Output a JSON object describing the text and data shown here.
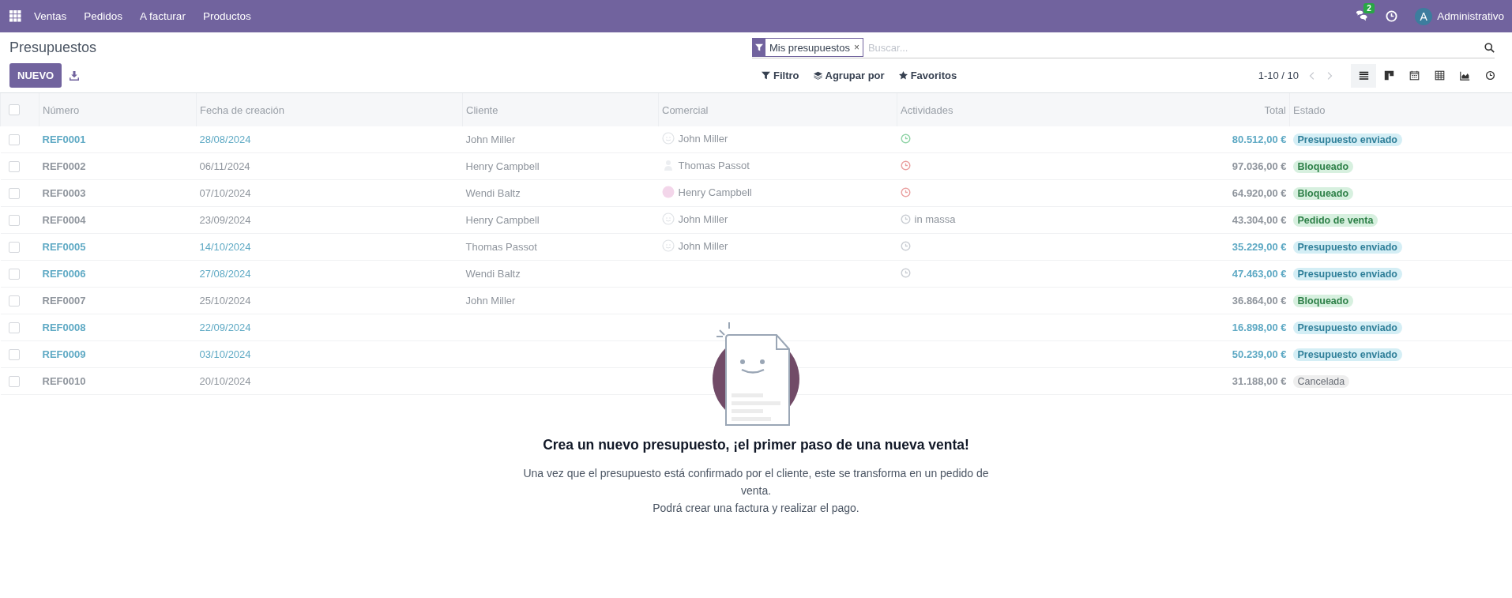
{
  "navbar": {
    "app": "Ventas",
    "menus": [
      "Pedidos",
      "A facturar",
      "Productos"
    ],
    "messages_count": "2",
    "user_initial": "A",
    "user_name": "Administrativo"
  },
  "control_panel": {
    "title": "Presupuestos",
    "new_button": "NUEVO",
    "facet": "Mis presupuestos",
    "facet_remove": "×",
    "search_placeholder": "Buscar...",
    "filters": [
      {
        "kind": "filter",
        "label": "Filtro"
      },
      {
        "kind": "group",
        "label": "Agrupar por"
      },
      {
        "kind": "favorite",
        "label": "Favoritos"
      }
    ],
    "pager": "1-10 / 10",
    "views": [
      {
        "kind": "list",
        "selected": true
      },
      {
        "kind": "kanban",
        "selected": false
      },
      {
        "kind": "calendar",
        "selected": false
      },
      {
        "kind": "pivot",
        "selected": false
      },
      {
        "kind": "graph",
        "selected": false
      },
      {
        "kind": "activity",
        "selected": false
      }
    ]
  },
  "table": {
    "all_checked": false,
    "columns": [
      "Número",
      "Fecha de creación",
      "Cliente",
      "Comercial",
      "Actividades",
      "Total",
      "Estado"
    ],
    "rows": [
      {
        "checked": false,
        "number": "REF0001",
        "date": "28/08/2024",
        "customer": "John Miller",
        "salesperson": {
          "kind": "face",
          "name": "John Miller"
        },
        "activity": {
          "kind": "planned"
        },
        "total": "80.512,00 €",
        "status": "Presupuesto enviado",
        "color": "#d4eef5",
        "info": true
      },
      {
        "checked": false,
        "number": "REF0002",
        "date": "06/11/2024",
        "customer": "Henry Campbell",
        "salesperson": {
          "kind": "person",
          "name": "Thomas Passot"
        },
        "activity": {
          "kind": "overdue"
        },
        "total": "97.036,00 €",
        "status": "Bloqueado",
        "color": "#d7f0df",
        "info": false
      },
      {
        "checked": false,
        "number": "REF0003",
        "date": "07/10/2024",
        "customer": "Wendi Baltz",
        "salesperson": {
          "kind": "letter",
          "name": "Henry Campbell"
        },
        "activity": {
          "kind": "overdue"
        },
        "total": "64.920,00 €",
        "status": "Bloqueado",
        "color": "#d7f0df",
        "info": false
      },
      {
        "checked": false,
        "number": "REF0004",
        "date": "23/09/2024",
        "customer": "Henry Campbell",
        "salesperson": {
          "kind": "face",
          "name": "John Miller"
        },
        "activity": {
          "kind": "none",
          "text": "in massa"
        },
        "total": "43.304,00 €",
        "status": "Pedido de venta",
        "color": "#d7f0df",
        "info": false
      },
      {
        "checked": false,
        "number": "REF0005",
        "date": "14/10/2024",
        "customer": "Thomas Passot",
        "salesperson": {
          "kind": "face",
          "name": "John Miller"
        },
        "activity": {
          "kind": "none"
        },
        "total": "35.229,00 €",
        "status": "Presupuesto enviado",
        "color": "#d4eef5",
        "info": true
      },
      {
        "checked": false,
        "number": "REF0006",
        "date": "27/08/2024",
        "customer": "Wendi Baltz",
        "activity": {
          "kind": "none"
        },
        "total": "47.463,00 €",
        "status": "Presupuesto enviado",
        "color": "#d4eef5",
        "info": true
      },
      {
        "checked": false,
        "number": "REF0007",
        "date": "25/10/2024",
        "customer": "John Miller",
        "total": "36.864,00 €",
        "status": "Bloqueado",
        "color": "#d7f0df",
        "info": false
      },
      {
        "checked": false,
        "number": "REF0008",
        "date": "22/09/2024",
        "total": "16.898,00 €",
        "status": "Presupuesto enviado",
        "color": "#d4eef5",
        "info": true
      },
      {
        "checked": false,
        "number": "REF0009",
        "date": "03/10/2024",
        "total": "50.239,00 €",
        "status": "Presupuesto enviado",
        "color": "#d4eef5",
        "info": true
      },
      {
        "checked": false,
        "number": "REF0010",
        "date": "20/10/2024",
        "total": "31.188,00 €",
        "status": "Cancelada",
        "color": "#eeeeee",
        "info": false
      }
    ]
  },
  "helper": {
    "title": "Crea un nuevo presupuesto, ¡el primer paso de una nueva venta!",
    "lines": [
      "Una vez que el presupuesto está confirmado por el cliente, este se transforma en un pedido de venta.",
      "Podrá crear una factura y realizar el pago."
    ]
  }
}
